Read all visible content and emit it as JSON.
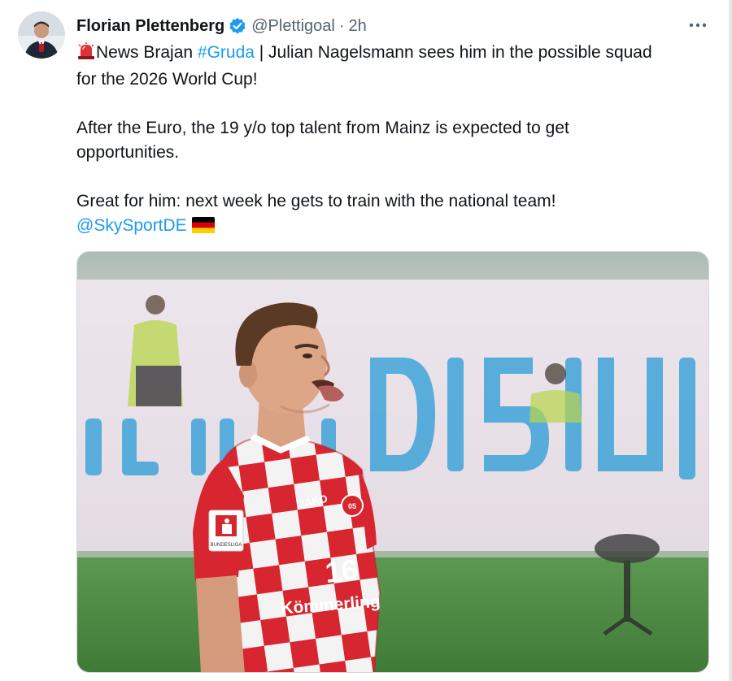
{
  "author": {
    "display_name": "Florian Plettenberg",
    "handle": "@Plettigoal",
    "separator": "·",
    "time": "2h",
    "verified": true,
    "verified_color": "#1d9bf0"
  },
  "more_icon": "more-horizontal-icon",
  "tweet": {
    "line1_emoji": "siren-icon",
    "line1_prefix": "News Brajan ",
    "hashtag": "#Gruda",
    "line1_rest": " | Julian Nagelsmann sees him in the possible squad",
    "line2": "for the 2026 World Cup!",
    "para2_line1": "After the Euro, the 19 y/o top talent from Mainz is expected to get",
    "para2_line2": "opportunities.",
    "para3_line1": "Great for him: next week he gets to train with the national team!",
    "mention": "@SkySportDE",
    "flag_icon": "germany-flag-icon"
  },
  "media": {
    "kind": "photo",
    "jersey_brand": "JAKO",
    "jersey_badge": "BUNDESLIGA",
    "jersey_sponsor": "Kömmerling",
    "jersey_number": "16"
  },
  "colors": {
    "link": "#1d9bf0",
    "text": "#0f1419",
    "secondary": "#536471"
  }
}
